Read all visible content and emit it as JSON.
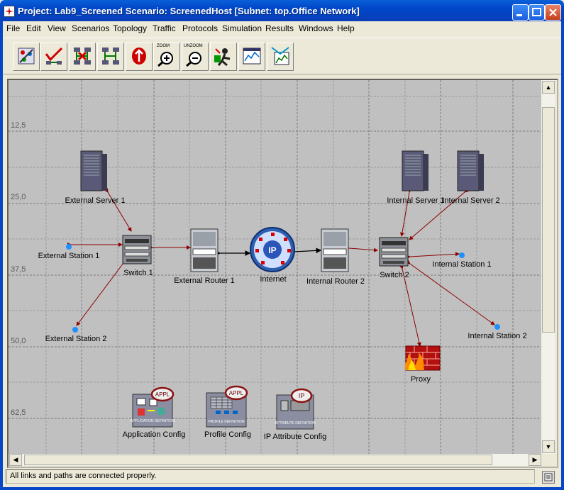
{
  "window": {
    "title": "Project: Lab9_Screened Scenario: ScreenedHost  [Subnet: top.Office Network]",
    "buttons": [
      "minimize",
      "maximize",
      "close"
    ]
  },
  "menu": [
    "File",
    "Edit",
    "View",
    "Scenarios",
    "Topology",
    "Traffic",
    "Protocols",
    "Simulation",
    "Results",
    "Windows",
    "Help"
  ],
  "toolbar": {
    "buttons": [
      {
        "icon": "object-palette-icon"
      },
      {
        "icon": "check-links-icon"
      },
      {
        "icon": "fail-link-icon"
      },
      {
        "icon": "recover-link-icon"
      },
      {
        "icon": "return-to-parent-icon"
      },
      {
        "icon": "zoom-icon",
        "label": "ZOOM"
      },
      {
        "icon": "unzoom-icon",
        "label": "UNZOOM"
      },
      {
        "icon": "configure-simulation-icon"
      },
      {
        "icon": "view-results-icon"
      },
      {
        "icon": "hide-graphs-icon"
      }
    ]
  },
  "grid": {
    "y_labels": [
      "12,5",
      "25,0",
      "37,5",
      "50,0",
      "62,5"
    ]
  },
  "nodes": {
    "external_server_1": "External Server 1",
    "external_station_1": "External Station 1",
    "external_station_2": "External Station 2",
    "switch_1": "Switch 1",
    "external_router_1": "External Router 1",
    "internet": "Internet",
    "internal_router_2": "Internal Router 2",
    "switch_2": "Switch 2",
    "internal_server_1": "Internal Server 1",
    "internal_server_2": "Internal Server 2",
    "internal_station_1": "Internal Station 1",
    "internal_station_2": "Internal Station 2",
    "proxy": "Proxy",
    "application_config": "Application Config",
    "profile_config": "Profile Config",
    "ip_attribute_config": "IP Attribute Config"
  },
  "node_badges": {
    "appl": "APPL",
    "ip": "IP",
    "application_definition": "APPLICATION DEFINITION",
    "profile_definition": "PROFILE DEFINITION",
    "attribute_definition": "ATTRIBUTE DEFINITION"
  },
  "status": {
    "message": "All links and paths are connected properly."
  },
  "colors": {
    "link_red": "#8b0000",
    "link_black": "#000000",
    "canvas_bg": "#c0c0c0",
    "station_blue": "#1e90ff"
  }
}
